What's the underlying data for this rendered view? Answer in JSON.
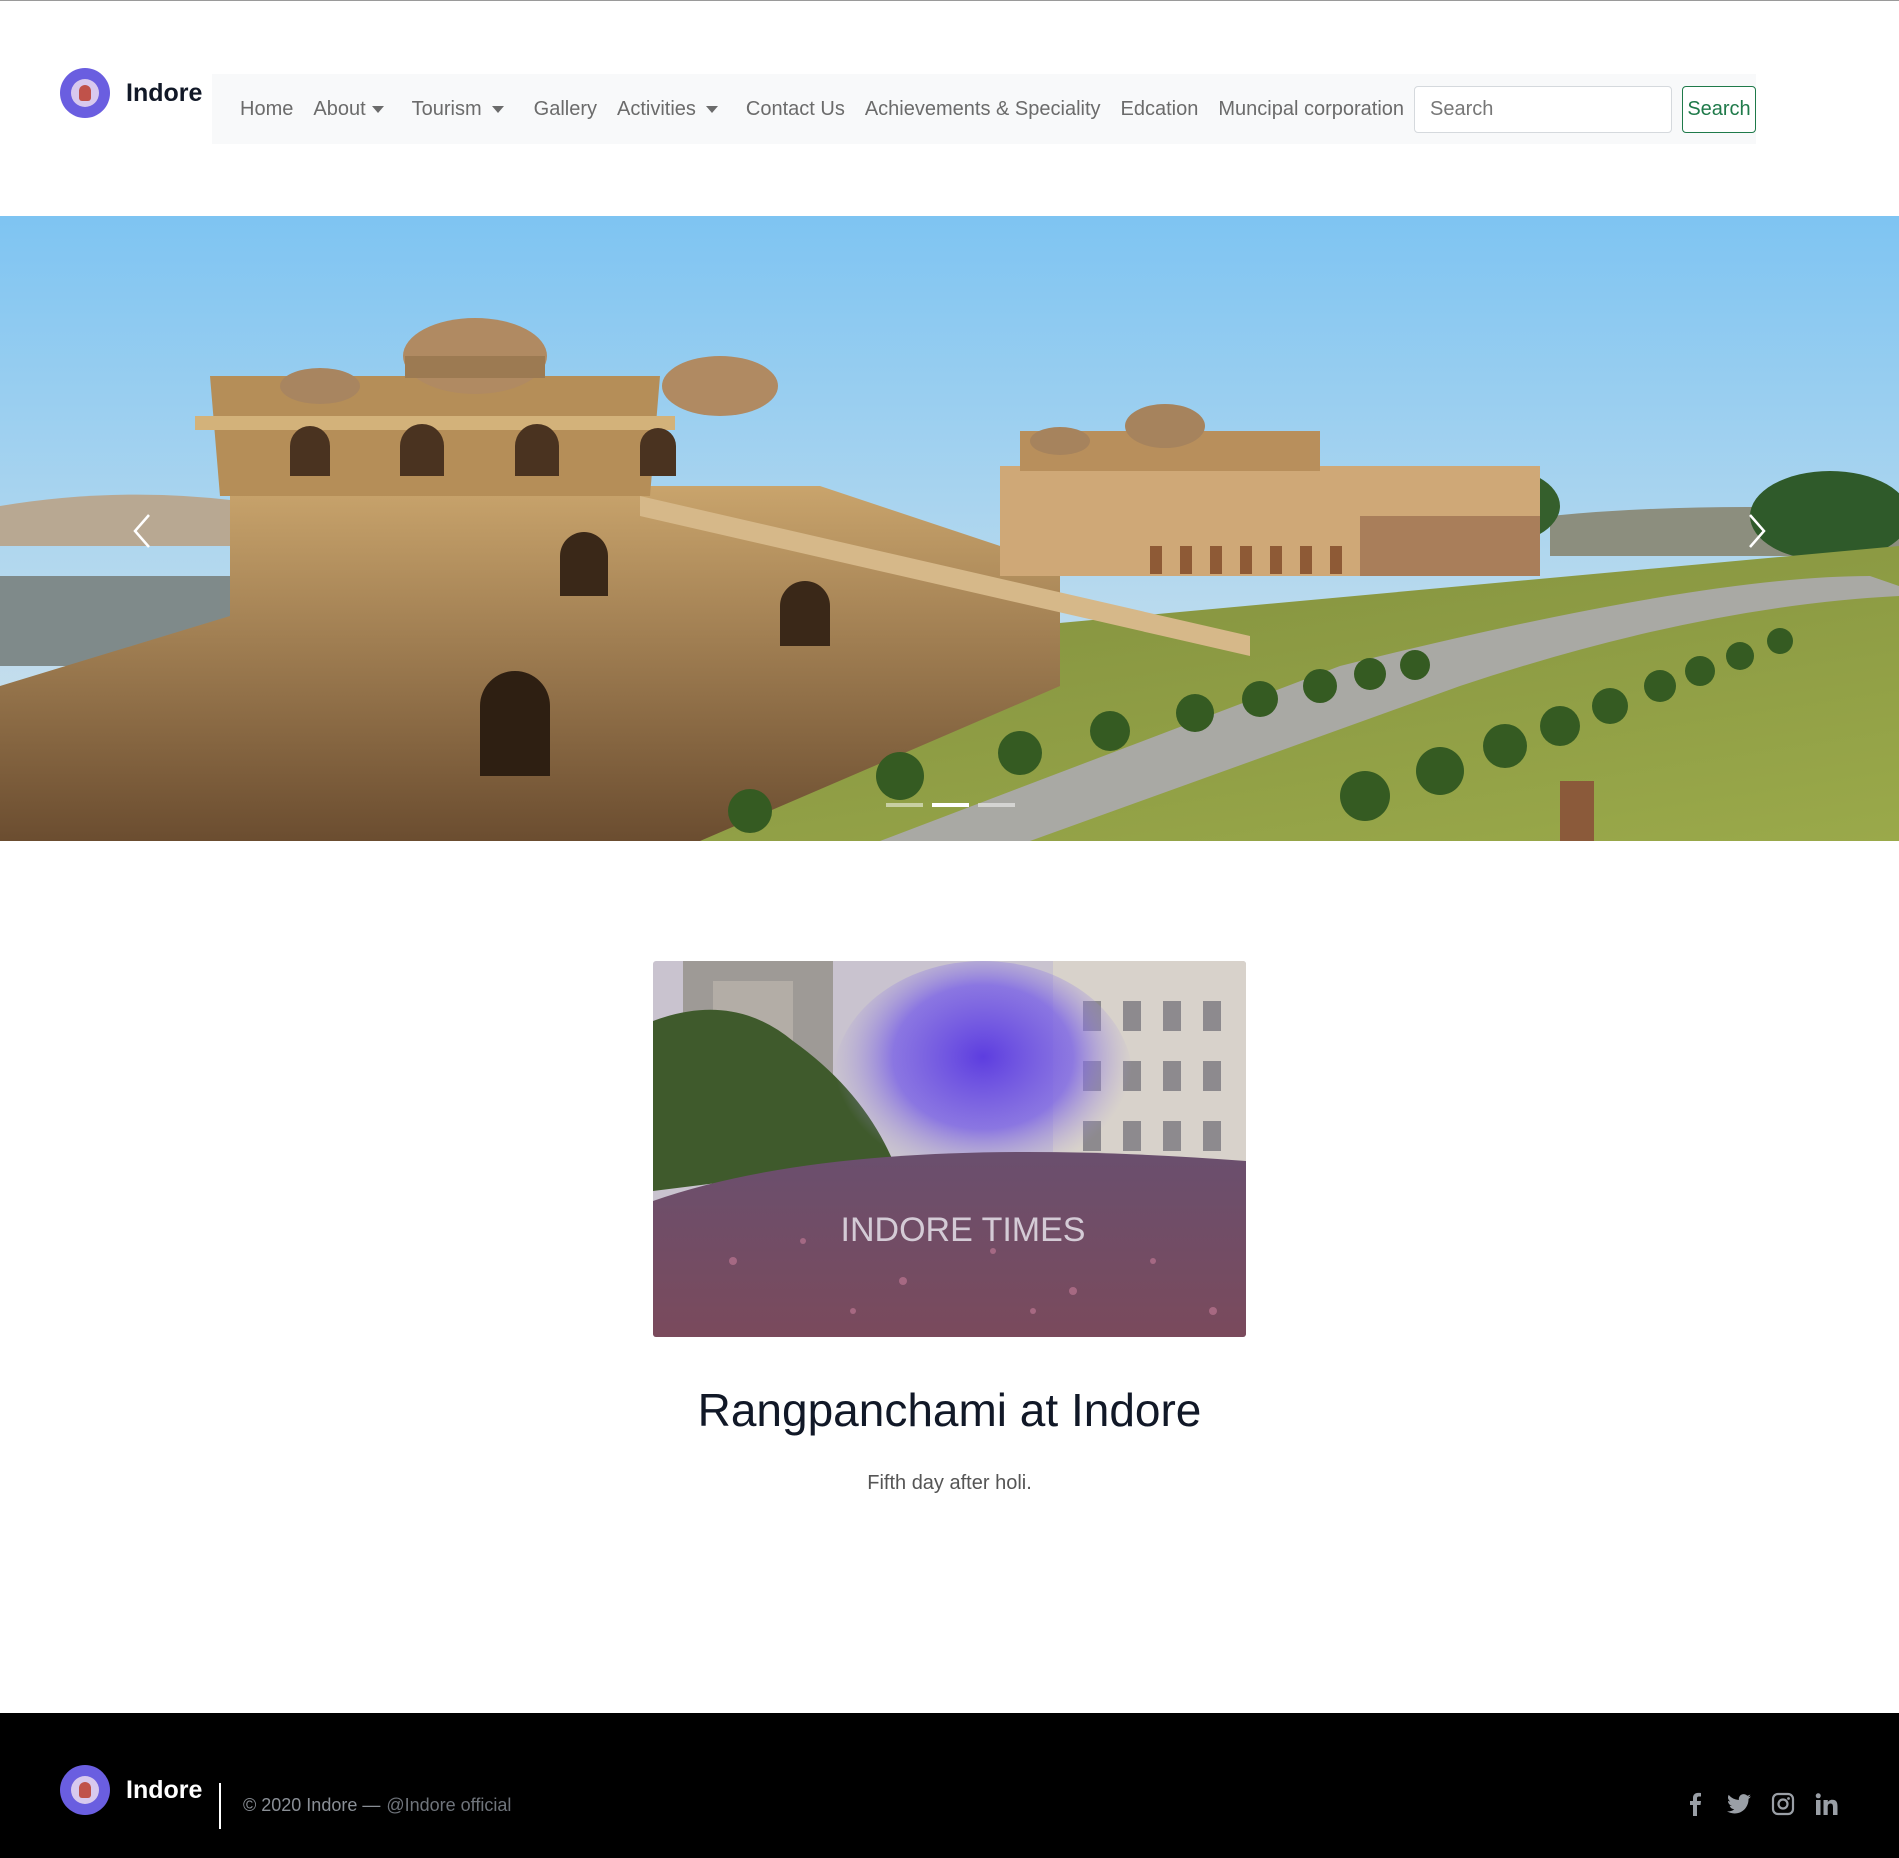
{
  "brand": {
    "name": "Indore"
  },
  "nav": {
    "items": [
      {
        "label": "Home",
        "dropdown": false
      },
      {
        "label": "About",
        "dropdown": true
      },
      {
        "label": "Tourism",
        "dropdown": true
      },
      {
        "label": "Gallery",
        "dropdown": false
      },
      {
        "label": "Activities",
        "dropdown": true
      },
      {
        "label": "Contact Us",
        "dropdown": false
      },
      {
        "label": "Achievements & Speciality",
        "dropdown": false
      },
      {
        "label": "Edcation",
        "dropdown": false
      },
      {
        "label": "Muncipal corporation",
        "dropdown": false
      }
    ],
    "search_placeholder": "Search",
    "search_button": "Search"
  },
  "carousel": {
    "slide_count": 3,
    "active_index": 1,
    "prev_icon": "chevron-left-icon",
    "next_icon": "chevron-right-icon"
  },
  "feature": {
    "image_watermark": "INDORE TIMES",
    "title": "Rangpanchami at Indore",
    "subtitle": "Fifth day after holi."
  },
  "footer": {
    "brand": "Indore",
    "copyright": "© 2020 Indore —",
    "handle": "@Indore official",
    "social": [
      "facebook-icon",
      "twitter-icon",
      "instagram-icon",
      "linkedin-icon"
    ]
  },
  "colors": {
    "nav_bg": "#f8f9fa",
    "search_button": "#1f7a4a",
    "footer_bg": "#000000",
    "logo": "#6a5ee0"
  }
}
